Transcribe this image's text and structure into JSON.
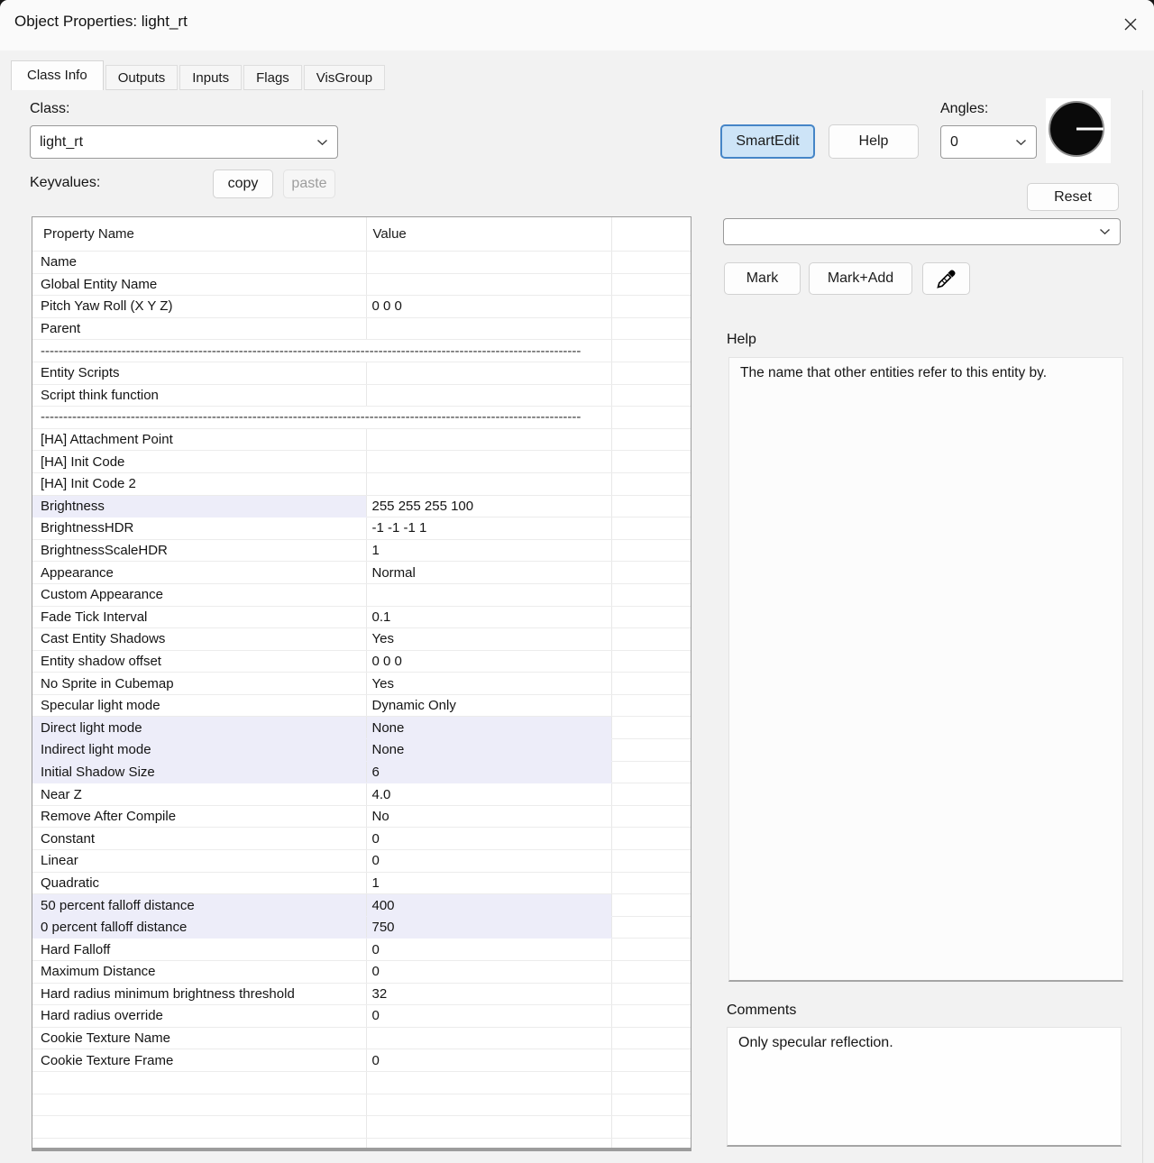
{
  "window": {
    "title": "Object Properties: light_rt"
  },
  "tabs": [
    {
      "label": "Class Info",
      "active": true
    },
    {
      "label": "Outputs",
      "active": false
    },
    {
      "label": "Inputs",
      "active": false
    },
    {
      "label": "Flags",
      "active": false
    },
    {
      "label": "VisGroup",
      "active": false
    }
  ],
  "class_section": {
    "label": "Class:",
    "value": "light_rt"
  },
  "keyvalues": {
    "label": "Keyvalues:",
    "copy_label": "copy",
    "paste_label": "paste"
  },
  "toolbar": {
    "smartedit_label": "SmartEdit",
    "help_label": "Help",
    "reset_label": "Reset",
    "mark_label": "Mark",
    "mark_add_label": "Mark+Add"
  },
  "angles": {
    "label": "Angles:",
    "value": "0"
  },
  "filter_combo": {
    "value": ""
  },
  "help_panel": {
    "label": "Help",
    "text": "The name that other entities refer to this entity by."
  },
  "comments_panel": {
    "label": "Comments",
    "text": "Only specular reflection."
  },
  "table": {
    "headers": [
      "Property Name",
      "Value"
    ],
    "separator": "------------------------------------------------------------------------------------------------------------------------",
    "rows": [
      {
        "n": "Name",
        "v": "",
        "h": ""
      },
      {
        "n": "Global Entity Name",
        "v": "",
        "h": ""
      },
      {
        "n": "Pitch Yaw Roll (X Y Z)",
        "v": "0 0 0",
        "h": ""
      },
      {
        "n": "Parent",
        "v": "",
        "h": ""
      },
      {
        "sep": true
      },
      {
        "n": "Entity Scripts",
        "v": "",
        "h": ""
      },
      {
        "n": "Script think function",
        "v": "",
        "h": ""
      },
      {
        "sep": true
      },
      {
        "n": "[HA] Attachment Point",
        "v": "",
        "h": ""
      },
      {
        "n": "[HA] Init Code",
        "v": "",
        "h": ""
      },
      {
        "n": "[HA] Init Code 2",
        "v": "",
        "h": ""
      },
      {
        "n": "Brightness",
        "v": "255 255 255 100",
        "h": "name"
      },
      {
        "n": "BrightnessHDR",
        "v": "-1 -1 -1 1",
        "h": ""
      },
      {
        "n": "BrightnessScaleHDR",
        "v": "1",
        "h": ""
      },
      {
        "n": "Appearance",
        "v": "Normal",
        "h": ""
      },
      {
        "n": "Custom Appearance",
        "v": "",
        "h": ""
      },
      {
        "n": "Fade Tick Interval",
        "v": "0.1",
        "h": ""
      },
      {
        "n": "Cast Entity Shadows",
        "v": "Yes",
        "h": ""
      },
      {
        "n": "Entity shadow offset",
        "v": "0 0 0",
        "h": ""
      },
      {
        "n": "No Sprite in Cubemap",
        "v": "Yes",
        "h": ""
      },
      {
        "n": "Specular light mode",
        "v": "Dynamic Only",
        "h": ""
      },
      {
        "n": "Direct light mode",
        "v": "None",
        "h": "row"
      },
      {
        "n": "Indirect light mode",
        "v": "None",
        "h": "row"
      },
      {
        "n": "Initial Shadow Size",
        "v": "6",
        "h": "row"
      },
      {
        "n": "Near Z",
        "v": "4.0",
        "h": ""
      },
      {
        "n": "Remove After Compile",
        "v": "No",
        "h": ""
      },
      {
        "n": "Constant",
        "v": "0",
        "h": ""
      },
      {
        "n": "Linear",
        "v": "0",
        "h": ""
      },
      {
        "n": "Quadratic",
        "v": "1",
        "h": ""
      },
      {
        "n": "50 percent falloff distance",
        "v": "400",
        "h": "row"
      },
      {
        "n": "0 percent falloff distance",
        "v": "750",
        "h": "row"
      },
      {
        "n": "Hard Falloff",
        "v": "0",
        "h": ""
      },
      {
        "n": "Maximum Distance",
        "v": "0",
        "h": ""
      },
      {
        "n": "Hard radius minimum brightness threshold",
        "v": "32",
        "h": ""
      },
      {
        "n": "Hard radius override",
        "v": "0",
        "h": ""
      },
      {
        "n": "Cookie Texture Name",
        "v": "",
        "h": ""
      },
      {
        "n": "Cookie Texture Frame",
        "v": "0",
        "h": ""
      },
      {
        "n": "",
        "v": "",
        "h": ""
      },
      {
        "n": "",
        "v": "",
        "h": ""
      },
      {
        "n": "",
        "v": "",
        "h": ""
      },
      {
        "n": "",
        "v": "",
        "h": ""
      }
    ]
  },
  "colors": {
    "row_highlight": "#ededf9",
    "smartedit_active_bg": "#cde4f7",
    "smartedit_active_border": "#4585c7",
    "window_bg": "#f2f2f2",
    "titlebar_bg": "#fafafa"
  }
}
